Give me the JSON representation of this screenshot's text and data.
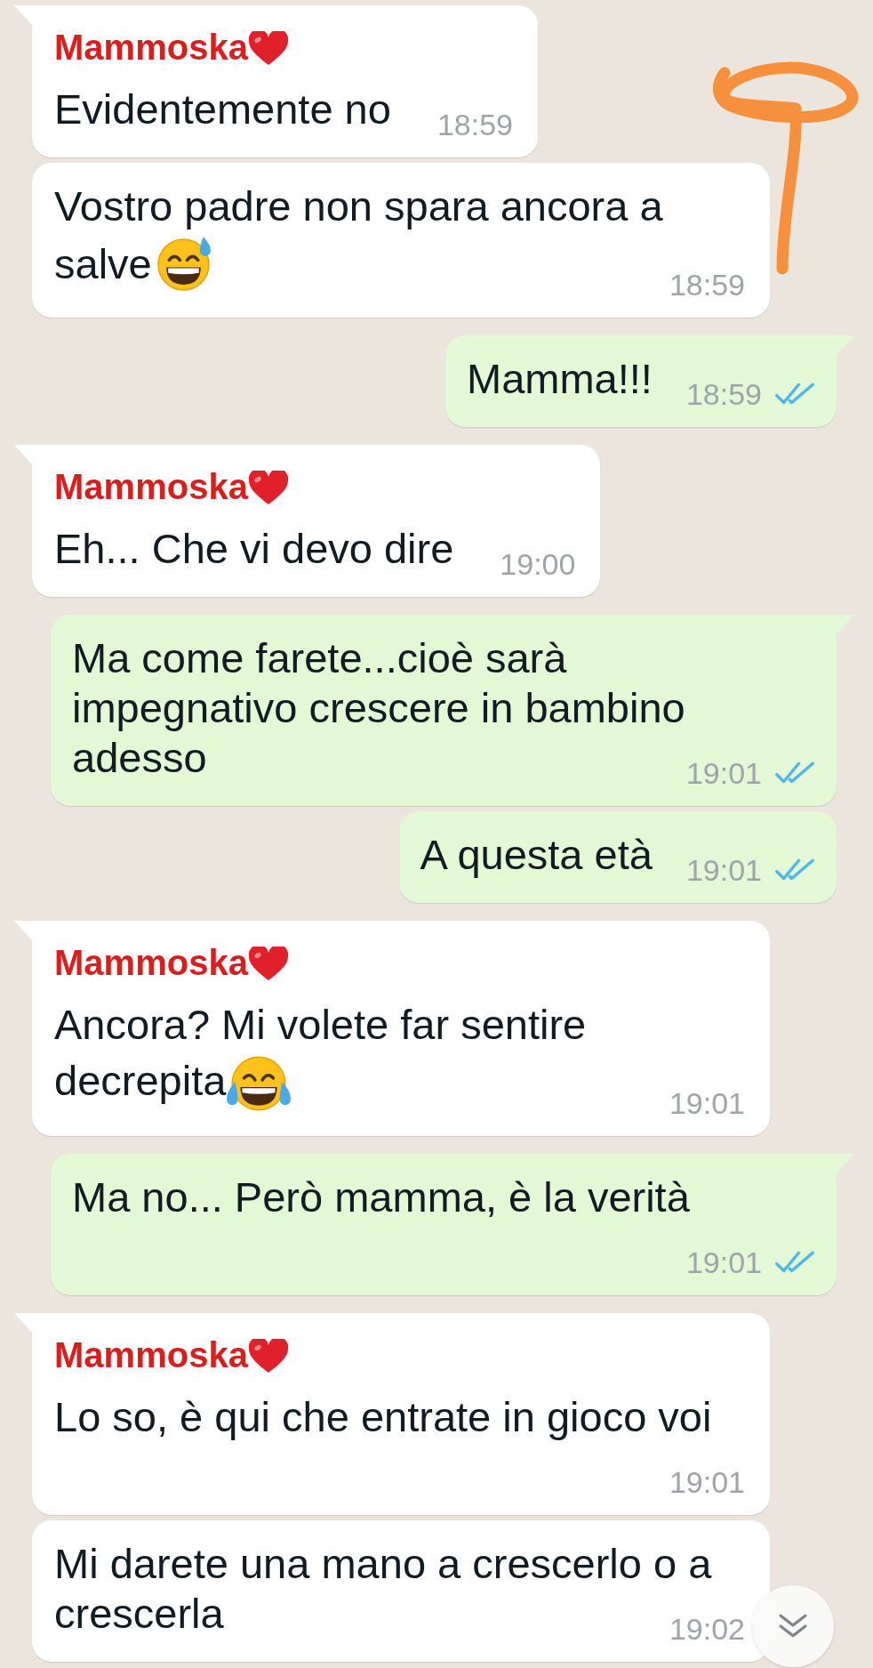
{
  "chat": {
    "messages": [
      {
        "kind": "incoming",
        "sender": "Mammoska",
        "sender_badge": {
          "kind": "heart"
        },
        "text": "Evidentemente no",
        "time": "18:59"
      },
      {
        "kind": "incoming",
        "lines": [
          "Vostro padre non spara ancora a",
          "salve"
        ],
        "emoji": {
          "kind": "sweat"
        },
        "time": "18:59"
      },
      {
        "kind": "outgoing",
        "text": "Mamma!!!",
        "time": "18:59",
        "read": true
      },
      {
        "kind": "incoming",
        "sender": "Mammoska",
        "sender_badge": {
          "kind": "heart"
        },
        "text": "Eh... Che vi devo dire",
        "time": "19:00"
      },
      {
        "kind": "outgoing",
        "lines": [
          "Ma come farete...cioè sarà",
          "impegnativo crescere in bambino",
          "adesso"
        ],
        "time": "19:01",
        "read": true
      },
      {
        "kind": "outgoing",
        "text": "A questa età",
        "time": "19:01",
        "read": true
      },
      {
        "kind": "incoming",
        "sender": "Mammoska",
        "sender_badge": {
          "kind": "heart"
        },
        "lines": [
          "Ancora? Mi volete far sentire",
          "decrepita"
        ],
        "emoji": {
          "kind": "joy"
        },
        "time": "19:01"
      },
      {
        "kind": "outgoing",
        "text": "Ma no... Però mamma, è la verità",
        "time": "19:01",
        "read": true
      },
      {
        "kind": "incoming",
        "sender": "Mammoska",
        "sender_badge": {
          "kind": "heart"
        },
        "text": "Lo so, è qui che entrate in gioco voi",
        "time": "19:01"
      },
      {
        "kind": "incoming",
        "lines": [
          "Mi darete una mano a crescerlo o a",
          "crescerla"
        ],
        "time": "19:02"
      }
    ]
  }
}
